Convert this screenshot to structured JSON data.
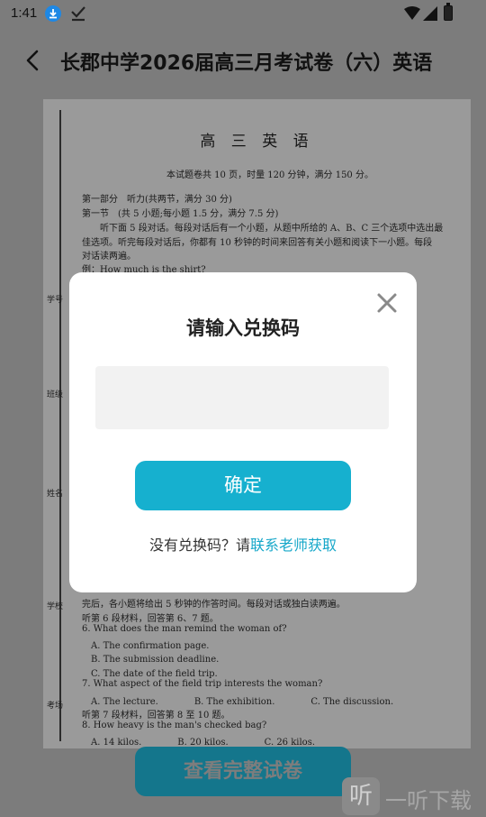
{
  "status_bar": {
    "time": "1:41"
  },
  "header": {
    "title": "长郡中学2026届高三月考试卷（六）英语"
  },
  "paper": {
    "side_labels": [
      "学号",
      "班级",
      "姓名",
      "学校",
      "考场"
    ],
    "title": "高 三 英 语",
    "lines_top": [
      "本试题卷共 10 页，时量 120 分钟，满分 150 分。",
      "第一部分　听力(共两节，满分 30 分)",
      "第一节　(共 5 小题;每小题 1.5 分，满分 7.5 分)",
      "　　听下面 5 段对话。每段对话后有一个小题，从题中所给的 A、B、C 三个选项中选出最",
      "佳选项。听完每段对话后，你都有 10 秒钟的时间来回答有关小题和阅读下一小题。每段",
      "对话读两遍。",
      "例：How much is the shirt?"
    ],
    "lines_bottom": [
      "完后，各小题将给出 5 秒钟的作答时间。每段对话或独白读两遍。",
      "听第 6 段材料，回答第 6、7 题。",
      "6. What does the man remind the woman of?",
      "　A. The confirmation page.",
      "　B. The submission deadline.",
      "　C. The date of the field trip.",
      "7. What aspect of the field trip interests the woman?",
      "　A. The lecture.　　　　B. The exhibition.　　　　C. The discussion.",
      "听第 7 段材料，回答第 8 至 10 题。",
      "8. How heavy is the man's checked bag?",
      "　A. 14 kilos.　　　　B. 20 kilos.　　　　C. 26 kilos."
    ]
  },
  "dialog": {
    "title": "请输入兑换码",
    "input_placeholder": "",
    "confirm_label": "确定",
    "hint_text": "没有兑换码？请",
    "contact_link": "联系老师获取"
  },
  "footer": {
    "view_full_label": "查看完整试卷"
  },
  "watermark": {
    "logo_char": "听",
    "text": "一听下载"
  },
  "colors": {
    "accent": "#16b0cf",
    "link": "#16a7c9",
    "overlay_gray": "#7c7c7c"
  }
}
